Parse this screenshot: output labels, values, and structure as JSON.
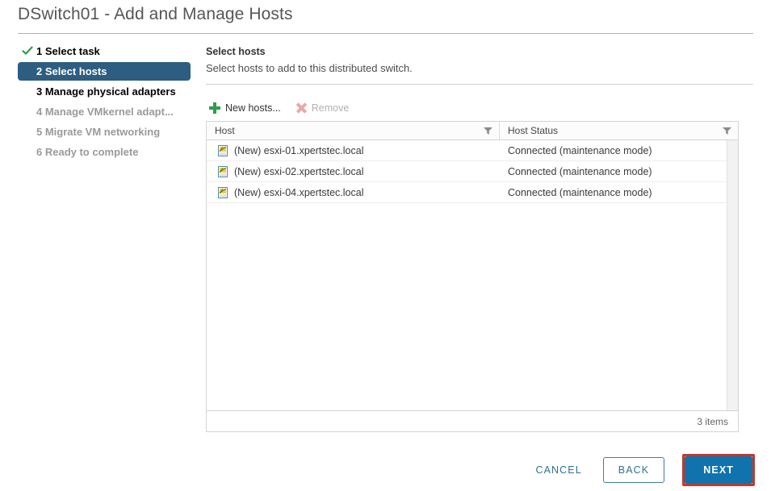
{
  "window": {
    "title": "DSwitch01 - Add and Manage Hosts"
  },
  "steps": [
    {
      "label": "1 Select task",
      "state": "completed"
    },
    {
      "label": "2 Select hosts",
      "state": "current"
    },
    {
      "label": "3 Manage physical adapters",
      "state": "enabled"
    },
    {
      "label": "4 Manage VMkernel adapt...",
      "state": "disabled"
    },
    {
      "label": "5 Migrate VM networking",
      "state": "disabled"
    },
    {
      "label": "6 Ready to complete",
      "state": "disabled"
    }
  ],
  "pane": {
    "title": "Select hosts",
    "subtitle": "Select hosts to add to this distributed switch."
  },
  "toolbar": {
    "new_hosts_label": "New hosts...",
    "remove_label": "Remove"
  },
  "table": {
    "columns": [
      "Host",
      "Host Status"
    ],
    "rows": [
      {
        "host": "(New) esxi-01.xpertstec.local",
        "status": "Connected (maintenance mode)"
      },
      {
        "host": "(New) esxi-02.xpertstec.local",
        "status": "Connected (maintenance mode)"
      },
      {
        "host": "(New) esxi-04.xpertstec.local",
        "status": "Connected (maintenance mode)"
      }
    ],
    "item_count_label": "3 items"
  },
  "footer": {
    "cancel_label": "CANCEL",
    "back_label": "BACK",
    "next_label": "NEXT"
  },
  "colors": {
    "step_current_bg": "#2d5d81",
    "check_green": "#2e9e4a",
    "plus_green": "#2e9e4a",
    "remove_disabled": "#e8a8a8",
    "link_teal": "#31718d",
    "primary_blue": "#1073ad",
    "highlight_red": "#c0392b"
  }
}
